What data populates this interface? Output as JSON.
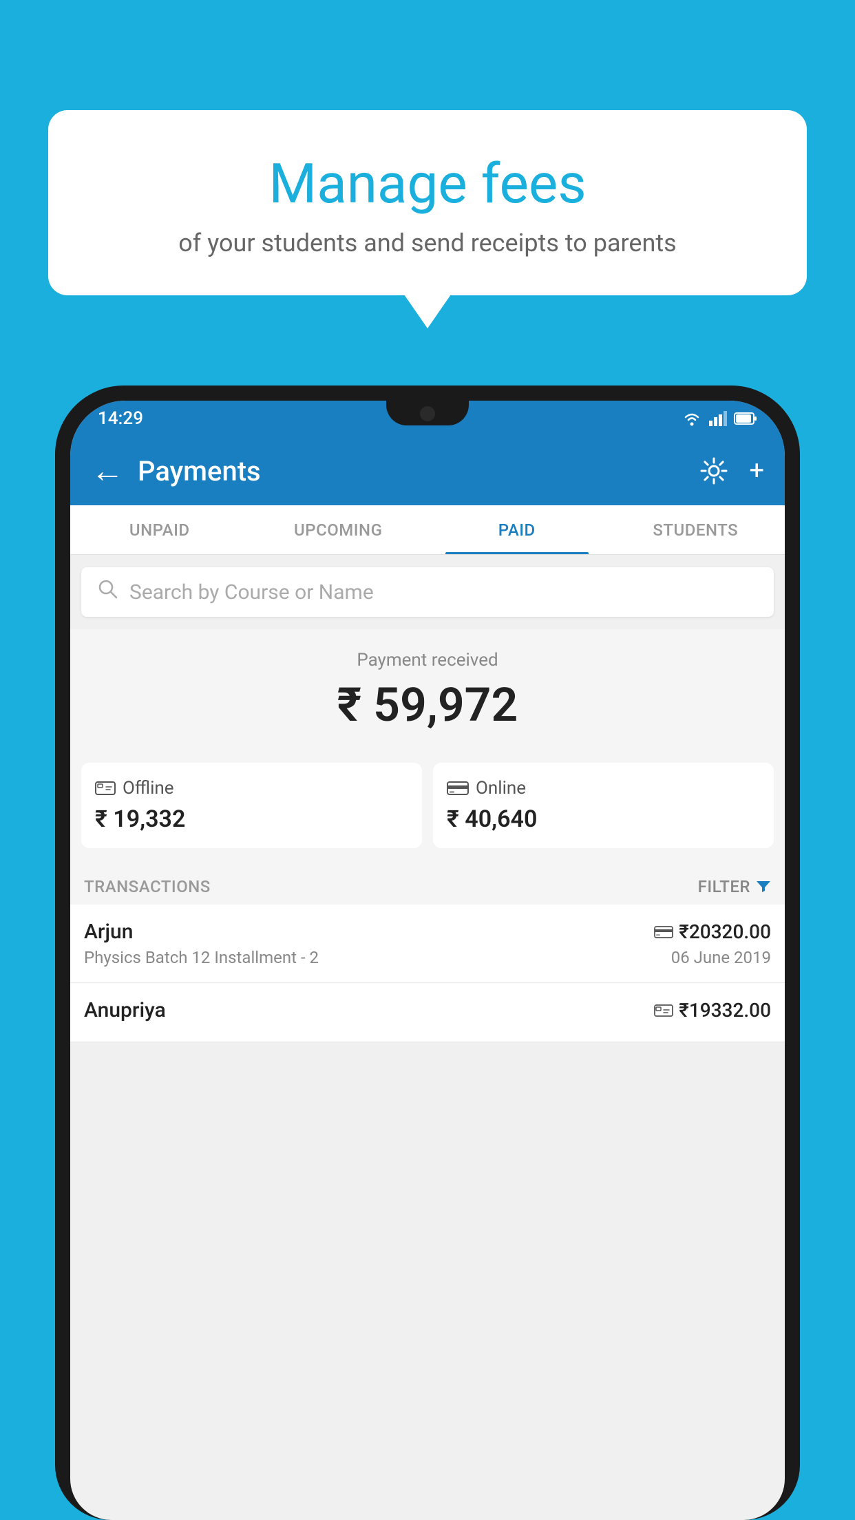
{
  "background": {
    "color": "#1AAFDC"
  },
  "speech_bubble": {
    "title": "Manage fees",
    "subtitle": "of your students and send receipts to parents"
  },
  "status_bar": {
    "time": "14:29",
    "icons": [
      "wifi",
      "signal",
      "battery"
    ]
  },
  "app_bar": {
    "back_icon": "←",
    "title": "Payments",
    "settings_icon": "⚙",
    "add_icon": "+"
  },
  "tabs": [
    {
      "label": "UNPAID",
      "active": false
    },
    {
      "label": "UPCOMING",
      "active": false
    },
    {
      "label": "PAID",
      "active": true
    },
    {
      "label": "STUDENTS",
      "active": false
    }
  ],
  "search": {
    "placeholder": "Search by Course or Name",
    "icon": "🔍"
  },
  "payment_received": {
    "label": "Payment received",
    "amount": "₹ 59,972"
  },
  "payment_cards": [
    {
      "icon": "offline",
      "label": "Offline",
      "amount": "₹ 19,332"
    },
    {
      "icon": "online",
      "label": "Online",
      "amount": "₹ 40,640"
    }
  ],
  "transactions_section": {
    "label": "TRANSACTIONS",
    "filter_label": "FILTER"
  },
  "transactions": [
    {
      "name": "Arjun",
      "course": "Physics Batch 12 Installment - 2",
      "amount": "₹20320.00",
      "date": "06 June 2019",
      "icon": "card"
    },
    {
      "name": "Anupriya",
      "course": "",
      "amount": "₹19332.00",
      "date": "",
      "icon": "offline"
    }
  ]
}
